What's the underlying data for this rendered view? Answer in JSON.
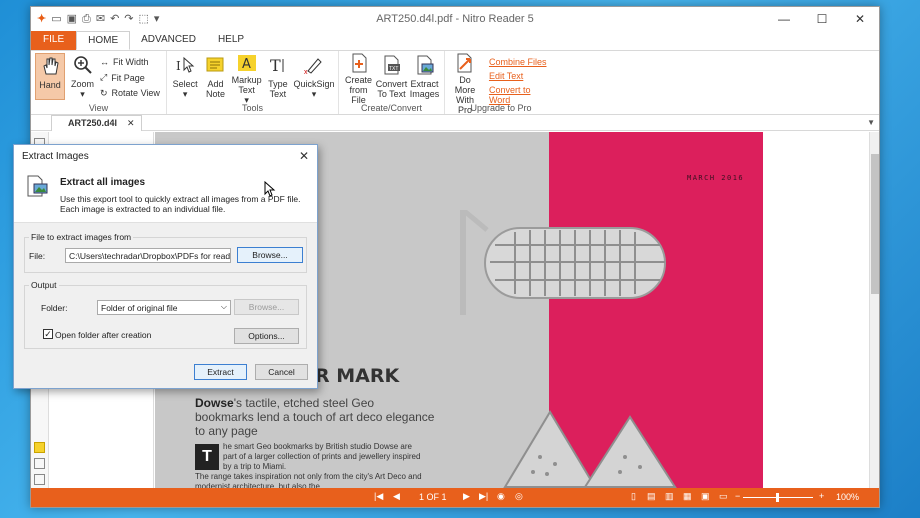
{
  "window": {
    "title": "ART250.d4l.pdf - Nitro Reader 5",
    "controls": [
      "—",
      "☐",
      "✕"
    ]
  },
  "quick_access": [
    "logo",
    "open-icon",
    "save-icon",
    "print-icon",
    "email-icon",
    "undo-icon",
    "redo-icon",
    "select-icon",
    "customize-icon"
  ],
  "tabs": {
    "file": "FILE",
    "home": "HOME",
    "advanced": "ADVANCED",
    "help": "HELP"
  },
  "ribbon": {
    "view": {
      "label": "View",
      "hand": "Hand",
      "zoom": "Zoom",
      "fit_width": "Fit Width",
      "fit_page": "Fit Page",
      "rotate_view": "Rotate View"
    },
    "tools": {
      "label": "Tools",
      "select": "Select",
      "add_note": "Add Note",
      "markup_text": "Markup Text",
      "type_text": "Type Text",
      "quicksign": "QuickSign"
    },
    "create_convert": {
      "label": "Create/Convert",
      "create_from_file": "Create from File",
      "convert_to_text": "Convert To Text",
      "extract_images": "Extract Images"
    },
    "upgrade": {
      "label": "Upgrade to Pro",
      "do_more": "Do More With Pro",
      "combine_files": "Combine Files",
      "edit_text": "Edit Text",
      "convert_to_word": "Convert to Word"
    }
  },
  "document_tab": {
    "name": "ART250.d4l",
    "close": "✕"
  },
  "magazine": {
    "date": "MARCH 2016",
    "headline": "R MARK",
    "sub_bold": "Dowse",
    "sub_rest": "'s tactile, etched steel Geo bookmarks lend a touch of art deco elegance to any page",
    "dropcap": "T",
    "body1": "he smart Geo bookmarks by British studio Dowse are part of a larger collection of prints and jewellery inspired by a trip to Miami.",
    "body2": "The range takes inspiration not only from the city's Art Deco and modernist architecture, but also the"
  },
  "status": {
    "page": "1 OF 1",
    "zoom": "100%"
  },
  "dialog": {
    "title": "Extract Images",
    "close": "✕",
    "heading": "Extract all images",
    "description": "Use this export tool to quickly extract all images from a PDF file. Each image is extracted to an individual file.",
    "file_section": "File to extract images from",
    "file_label": "File:",
    "file_value": "C:\\Users\\techradar\\Dropbox\\PDFs for readers\\",
    "browse": "Browse...",
    "output_section": "Output",
    "folder_label": "Folder:",
    "folder_value": "Folder of original file",
    "folder_browse": "Browse...",
    "open_folder": "Open folder after creation",
    "open_folder_checked": true,
    "options": "Options...",
    "extract": "Extract",
    "cancel": "Cancel"
  },
  "colors": {
    "accent": "#e8601c",
    "pink": "#dc1f5c",
    "grey_page": "#c8c8c8"
  }
}
